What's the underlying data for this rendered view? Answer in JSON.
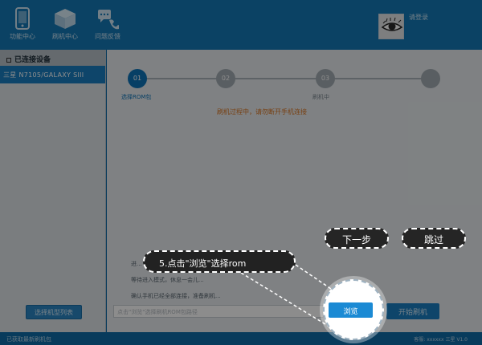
{
  "nav": [
    {
      "label": "功能中心",
      "icon": "phone-icon"
    },
    {
      "label": "刷机中心",
      "icon": "box-icon"
    },
    {
      "label": "问题反馈",
      "icon": "feedback-icon"
    }
  ],
  "user": {
    "name": "请登录"
  },
  "sidebar": {
    "header": "已连接设备",
    "device": "三星 N7105/GALAXY SIII",
    "bottom_button": "选择机型列表"
  },
  "steps": [
    {
      "num": "01",
      "label": "选择ROM包",
      "active": true
    },
    {
      "num": "02",
      "label": "",
      "active": false
    },
    {
      "num": "03",
      "label": "刷机中",
      "active": false
    },
    {
      "num": "",
      "label": "",
      "active": false
    }
  ],
  "status_text": "刷机过程中，请勿断开手机连接",
  "log": [
    "进...",
    "等待进入模式，休息一会儿...",
    "确认手机已经全部连接，准备刷机..."
  ],
  "path_input": {
    "placeholder": "点击\"浏览\"选择刷机ROM包路径"
  },
  "browse_label": "浏览",
  "start_label": "开始刷机",
  "tutorial": {
    "next_label": "下一步",
    "skip_label": "跳过",
    "hint": "5.点击\"浏览\"选择rom"
  },
  "footer": {
    "left": "已获取最新刷机包",
    "right": "客服: xxxxxx 三星 V1.0"
  },
  "colors": {
    "header": "#1479b7",
    "accent": "#0e74b8",
    "warning": "#d9731e"
  }
}
